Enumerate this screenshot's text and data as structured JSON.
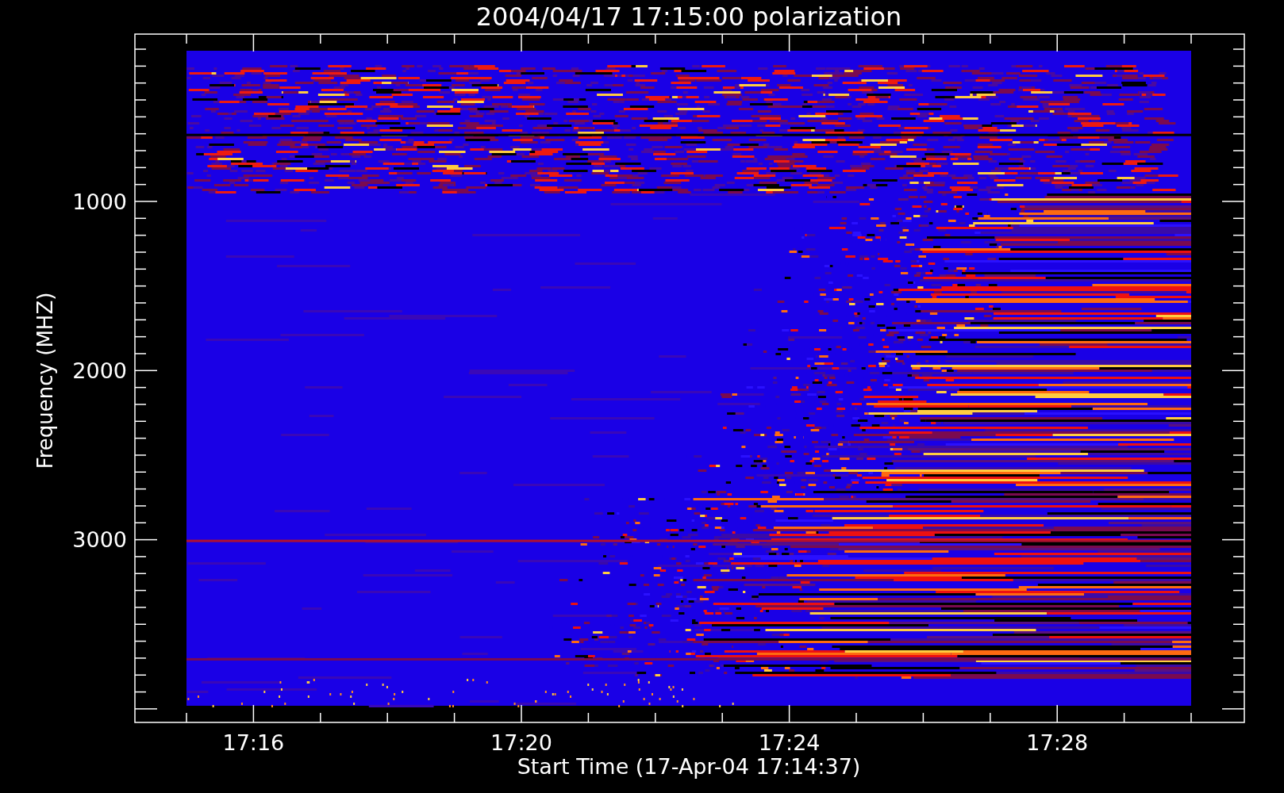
{
  "title": "2004/04/17 17:15:00 polarization",
  "y_axis": {
    "label": "Frequency (MHZ)",
    "ticks": [
      {
        "label": "1000"
      },
      {
        "label": "2000"
      },
      {
        "label": "3000"
      }
    ]
  },
  "x_axis": {
    "label": "Start Time (17-Apr-04 17:14:37)",
    "ticks": [
      {
        "label": "17:16"
      },
      {
        "label": "17:20"
      },
      {
        "label": "17:24"
      },
      {
        "label": "17:28"
      }
    ]
  }
}
